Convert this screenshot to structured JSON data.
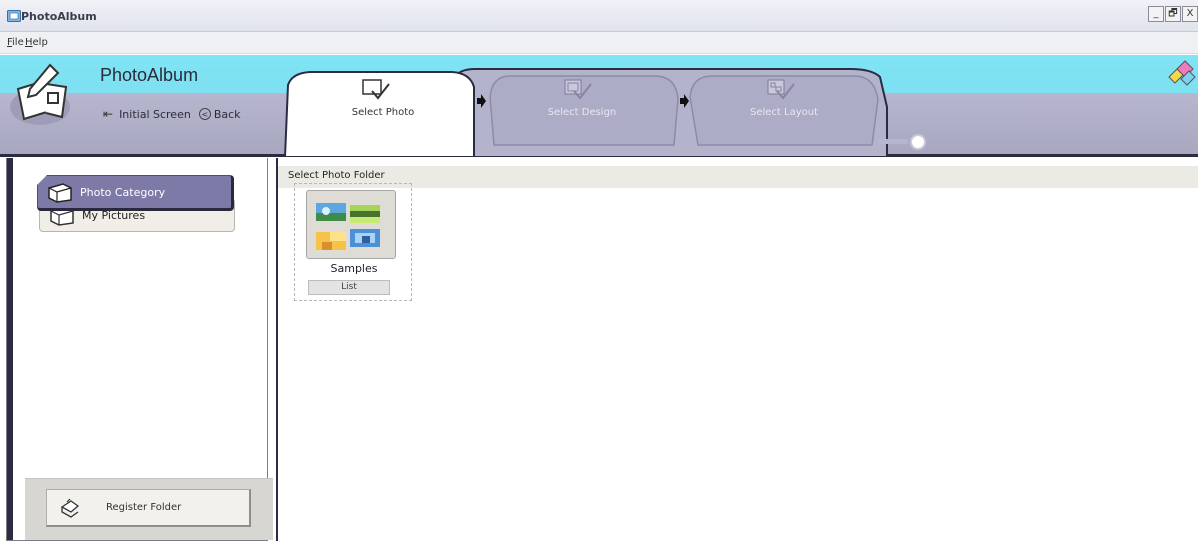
{
  "window": {
    "title": "PhotoAlbum",
    "controls": [
      "_",
      "🗗",
      "X"
    ]
  },
  "menu": {
    "file": "File",
    "help": "Help"
  },
  "header": {
    "app_name": "PhotoAlbum",
    "initial_screen": "Initial Screen",
    "back": "Back"
  },
  "steps": [
    {
      "label": "Select Photo",
      "state": "active"
    },
    {
      "label": "Select Design",
      "state": "disabled"
    },
    {
      "label": "Select Layout",
      "state": "disabled"
    }
  ],
  "sidebar": {
    "categories": [
      {
        "label": "Photo Category",
        "selected": true
      },
      {
        "label": "My Pictures",
        "selected": false
      }
    ],
    "register_folder": "Register Folder"
  },
  "main": {
    "section_title": "Select Photo Folder",
    "folders": [
      {
        "name": "Samples",
        "list_label": "List"
      }
    ]
  },
  "colors": {
    "header_cyan": "#7fe4f4",
    "header_purple": "#b7b6cf",
    "selected_category": "#7e7aa8",
    "dark_border": "#2b2b42"
  }
}
